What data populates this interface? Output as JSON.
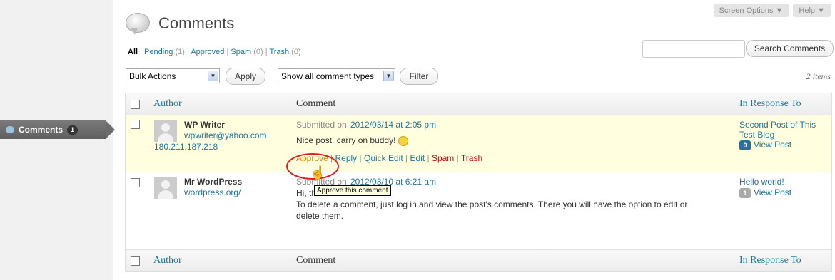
{
  "sidebar": {
    "menu_label": "Comments",
    "menu_count": "1"
  },
  "top_tabs": {
    "screen_options": "Screen Options ▼",
    "help": "Help ▼"
  },
  "page_title": "Comments",
  "filters": {
    "all": "All",
    "pending": "Pending",
    "pending_count": "(1)",
    "approved": "Approved",
    "spam": "Spam",
    "spam_count": "(0)",
    "trash": "Trash",
    "trash_count": "(0)"
  },
  "search": {
    "button": "Search Comments",
    "value": ""
  },
  "bulk": {
    "selected": "Bulk Actions",
    "apply": "Apply"
  },
  "type_filter": {
    "selected": "Show all comment types",
    "button": "Filter"
  },
  "items_count": "2 items",
  "columns": {
    "author": "Author",
    "comment": "Comment",
    "response": "In Response To"
  },
  "comments": [
    {
      "author": "WP Writer",
      "email": "wpwriter@yahoo.com",
      "ip": "180.211.187.218",
      "submitted_prefix": "Submitted on",
      "submitted_date": "2012/03/14 at 2:05 pm",
      "text": "Nice post. carry on buddy!",
      "response_post": "Second Post of This Test Blog",
      "response_count": "0",
      "view_post": "View Post",
      "actions": {
        "approve": "Approve",
        "reply": "Reply",
        "quick_edit": "Quick Edit",
        "edit": "Edit",
        "spam": "Spam",
        "trash": "Trash"
      }
    },
    {
      "author": "Mr WordPress",
      "url": "wordpress.org/",
      "submitted_prefix": "Submitted on",
      "submitted_date": "2012/03/10 at 6:21 am",
      "text_line1": "Hi, this is a comment.",
      "text_line2": "To delete a comment, just log in and view the post's comments. There you will have the option to edit or",
      "text_line3": "delete them.",
      "response_post": "Hello world!",
      "response_count": "1",
      "view_post": "View Post"
    }
  ],
  "tooltip": "Approve this comment"
}
